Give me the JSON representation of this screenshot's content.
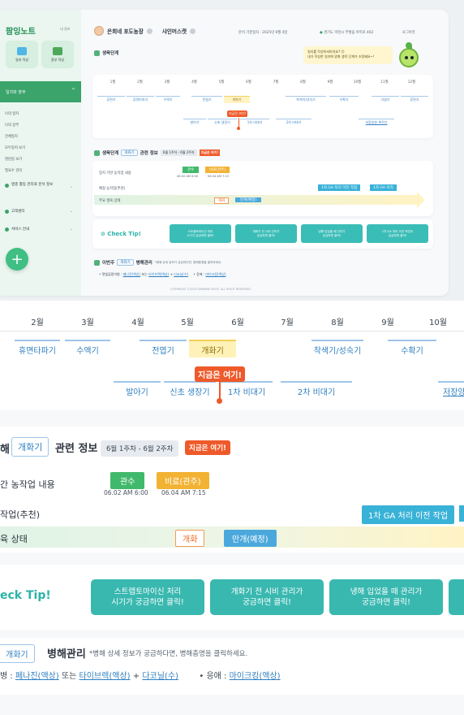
{
  "app": {
    "logo": "팜잉노트",
    "logo_tag": "내 정보",
    "quick": [
      {
        "label": "일지 작성",
        "color": "#4fb6e5"
      },
      {
        "label": "장부 작성",
        "color": "#4ea85c"
      }
    ]
  },
  "sidebar": {
    "main": "일지와 장부",
    "sub_items": [
      "나의 일지",
      "나의 장부",
      "전체일지",
      "모두일지 보기",
      "영린일 보기",
      "필요수 관리"
    ],
    "groups": [
      {
        "label": "병충 활동 관리와 분석 정보"
      },
      {
        "label": "고객센터"
      },
      {
        "label": "서비스 안내"
      }
    ],
    "fab": "+"
  },
  "header": {
    "user": "은희네 포도농장",
    "variety": "샤인머스캣",
    "base_date": "분석 기준일자 : 2025년 6월 4일",
    "location": "경기도 이천시 부발읍 아미로 402",
    "logout": "로그아웃",
    "bubble_line1": "일지를 작성하셔야지요? 😊",
    "bubble_line2": "내가 작성한 일지에 맞춰 생육 단계가 조정돼요~!"
  },
  "timeline": {
    "title": "생육단계",
    "months": [
      "1월",
      "2월",
      "3월",
      "4월",
      "5월",
      "6월",
      "7월",
      "8월",
      "9월",
      "10월",
      "11월",
      "12월"
    ],
    "row1": [
      "휴면기",
      "휴면타파기",
      "수액기",
      "전엽기",
      "개화기",
      "착색기/성숙기",
      "수확기",
      "낙엽기",
      "휴면기"
    ],
    "row2": [
      "발아기",
      "신초 생장기",
      "1차 비대기",
      "2차 비대기",
      "저장양분 축적기"
    ],
    "now_label": "지금은 여기!"
  },
  "stage_info": {
    "prefix": "생육단계",
    "stage": "개화기",
    "suffix": "관련 정보",
    "week_range": "6월 1주차 - 6월 2주차",
    "now": "지금은 여기!",
    "rows": [
      {
        "label": "일지 기반 농작업 내용",
        "tags": [
          "관수",
          "비료(관주)"
        ],
        "times": [
          "06.02 AM 6:00",
          "06.04 AM 7:15"
        ]
      },
      {
        "label": "예정 농작업(추천)",
        "tags": [
          "1차 GA 처리 이전 작업",
          "1차 GA 처리"
        ]
      },
      {
        "label": "주요 생육 상태",
        "tags": [
          "개화",
          "만개(예정)"
        ]
      }
    ]
  },
  "tip": {
    "title": "Check Tip!",
    "buttons": [
      {
        "line1": "스트렙토마이신 처리",
        "line2": "시기가 궁금하면 클릭!"
      },
      {
        "line1": "개화기 전 시비 관리가",
        "line2": "궁금하면 클릭!"
      },
      {
        "line1": "냉해 입었을 때 관리가",
        "line2": "궁금하면 클릭!"
      },
      {
        "line1": "1차 GA 처리 이전 작업이",
        "line2": "궁금하면 클릭!"
      }
    ]
  },
  "pest": {
    "prefix": "이번주",
    "stage": "개화기",
    "title": "병해관리",
    "note": "*병해 상세 정보가 궁금하다면, 병해충명을 클릭하세요.",
    "row_label": "잿빛곰팡이병 :",
    "link1": "페나진(액상)",
    "or": "또는",
    "link2": "타이브렉(액상)",
    "plus": "+",
    "link3": "다코닐(수)",
    "aphid": "응애 :",
    "link4": "마이크킹(액상)",
    "zoom_row_label": "병 :"
  },
  "footer": "COPYRIGHT ©2025 FARMING NOTE. ALL RIGHT RESERVED.",
  "zoom": {
    "months": [
      "2월",
      "3월",
      "4월",
      "5월",
      "6월",
      "7월",
      "8월",
      "9월",
      "10월"
    ],
    "row1": [
      "휴면타파기",
      "수액기",
      "전엽기",
      "개화기",
      "착색기/성숙기",
      "수확기"
    ],
    "row2": [
      "발아기",
      "신초 생장기",
      "1차 비대기",
      "2차 비대기",
      "저장양"
    ],
    "now": "지금은 여기!",
    "info_prefix": "해",
    "stage": "개화기",
    "info_title": "관련 정보",
    "week": "6월 1주차 - 6월 2주차",
    "row_a": "간 농작업 내용",
    "row_b": "작업(추천)",
    "row_c": "육 상태",
    "tags_a": [
      "관수",
      "비료(관주)"
    ],
    "times": [
      "06.02 AM 6:00",
      "06.04 AM 7:15"
    ],
    "tag_b": "1차 GA 처리 이전 작업",
    "tags_c": [
      "개화",
      "만개(예정)"
    ],
    "tip": "eck Tip!",
    "tip_buttons": [
      {
        "line1": "스트렙토마이신 처리",
        "line2": "시기가 궁금하면 클릭!"
      },
      {
        "line1": "개화기 전 시비 관리가",
        "line2": "궁금하면 클릭!"
      },
      {
        "line1": "냉해 입었을 때 관리가",
        "line2": "궁금하면 클릭!"
      }
    ]
  }
}
